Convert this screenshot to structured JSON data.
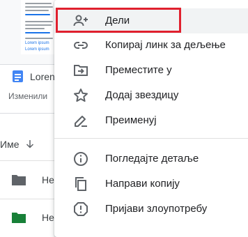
{
  "background": {
    "doc_preview_link_lines": [
      "Lorem ipsum",
      "Lorem ipsum"
    ],
    "card_title": "Loren",
    "card_subtitle": "Изменили",
    "sort_label": "Име",
    "rows": [
      {
        "name": "Не",
        "folder_color": "#5f6368"
      },
      {
        "name": "Не",
        "folder_color": "#188038"
      }
    ]
  },
  "menu": {
    "items": [
      {
        "label": "Дели",
        "icon": "person-add-icon"
      },
      {
        "label": "Копирај линк за дељење",
        "icon": "link-icon"
      },
      {
        "label": "Преместите у",
        "icon": "move-to-folder-icon"
      },
      {
        "label": "Додај звездицу",
        "icon": "star-outline-icon"
      },
      {
        "label": "Преименуј",
        "icon": "pencil-icon"
      },
      {
        "label": "Погледајте детаље",
        "icon": "info-icon"
      },
      {
        "label": "Направи копију",
        "icon": "copy-icon"
      },
      {
        "label": "Пријави злоупотребу",
        "icon": "report-icon"
      }
    ]
  },
  "colors": {
    "highlight_border": "#e0202e",
    "doc_blue": "#4285f4",
    "icon_gray": "#5f6368"
  }
}
